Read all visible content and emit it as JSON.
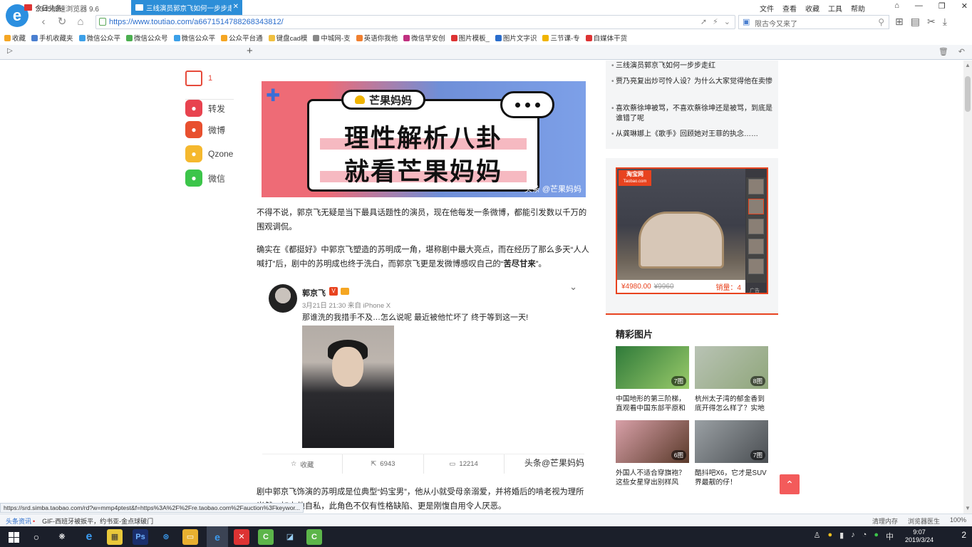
{
  "browser": {
    "title": "2345加速浏览器 9.6",
    "menu": [
      "文件",
      "查看",
      "收藏",
      "工具",
      "帮助"
    ],
    "url": "https://www.toutiao.com/a6671514788268343812/",
    "search_placeholder": "限古今又来了",
    "bookmarks": [
      {
        "label": "收藏",
        "color": "#f5a623"
      },
      {
        "label": "手机收藏夹",
        "color": "#4a7fd0"
      },
      {
        "label": "微信公众平",
        "color": "#3ca0e8"
      },
      {
        "label": "微信公众号",
        "color": "#4caf50"
      },
      {
        "label": "微信公众平",
        "color": "#3ca0e8"
      },
      {
        "label": "公众平台通",
        "color": "#f5a623"
      },
      {
        "label": "键盘cad模",
        "color": "#f0c040"
      },
      {
        "label": "中城网-支",
        "color": "#888888"
      },
      {
        "label": "英语你我他",
        "color": "#f08030"
      },
      {
        "label": "微信早安创",
        "color": "#c03080"
      },
      {
        "label": "图片模板_",
        "color": "#d33"
      },
      {
        "label": "图片文字识",
        "color": "#2a6dcc"
      },
      {
        "label": "三节课-专",
        "color": "#f0b400"
      },
      {
        "label": "自媒体干货",
        "color": "#d33"
      }
    ],
    "tabs": [
      {
        "label": "今日头条"
      },
      {
        "label": "三线演员郭京飞如何一步步走红"
      }
    ]
  },
  "share": {
    "comment_count": "1",
    "items": [
      {
        "label": "转发",
        "color": "#e8434f",
        "icon": "repost-icon"
      },
      {
        "label": "微博",
        "color": "#e8502f",
        "icon": "weibo-icon"
      },
      {
        "label": "Qzone",
        "color": "#f5b82e",
        "icon": "qzone-icon"
      },
      {
        "label": "微信",
        "color": "#3cc54a",
        "icon": "wechat-icon"
      }
    ]
  },
  "banner": {
    "brand": "芒果妈妈",
    "line1": "理性解析八卦",
    "line2": "就看芒果妈妈",
    "watermark": "头条 @芒果妈妈"
  },
  "article": {
    "p1": "不得不说，郭京飞无疑是当下最具话题性的演员，现在他每发一条微博，都能引发数以千万的围观调侃。",
    "p2_prefix": "确实在《都挺好》中郭京飞塑造的苏明成一角，堪称剧中最大亮点，而在经历了那么多天“人人喊打”后，剧中的苏明成也终于洗白，而郭京飞更是发微博感叹自己的“",
    "p2_bold": "苦尽甘来",
    "p2_suffix": "”。",
    "p3": "剧中郭京飞饰演的苏明成是位典型“妈宝男”，他从小就受母亲溺爱，并将婚后的啃老视为理所当然，加上他自私，此角色不仅有性格缺陷、更是刚愎自用令人厌恶。"
  },
  "weibo": {
    "name": "郭京飞",
    "time": "3月21日 21:30 来自 iPhone X",
    "text": "那谁洗的我措手不及…怎么说呢 最近被他忙坏了 终于等到这一天!",
    "actions": [
      {
        "label": "收藏",
        "icon": "star-icon"
      },
      {
        "label": "6943",
        "icon": "repost-icon"
      },
      {
        "label": "12214",
        "icon": "comment-icon"
      }
    ],
    "watermark": "头条@芒果妈妈"
  },
  "related": [
    "三线演员郭京飞如何一步步走红",
    "贾乃亮复出炒可怜人设？为什么大家觉得他在卖惨",
    "喜欢蔡徐坤被骂，不喜欢蔡徐坤还是被骂，到底是谁错了呢",
    "从龚琳娜上《歌手》回顾她对王菲的执念……"
  ],
  "ad": {
    "logo": "淘宝网",
    "logo_sub": "Taobao.com",
    "price": "¥4980.00",
    "old_price": "¥9960",
    "sales": "销量：4",
    "tag": "广告"
  },
  "pictures": {
    "title": "精彩图片",
    "items": [
      {
        "count": "7图",
        "caption": "中国地形的第三阶梯，直观看中国东部平原和",
        "colors": [
          "#2f7a3a",
          "#9acb6a"
        ]
      },
      {
        "count": "8图",
        "caption": "杭州太子湾的郁金香到底开得怎么样了？实地",
        "colors": [
          "#b9c3b5",
          "#8fa67a"
        ]
      },
      {
        "count": "6图",
        "caption": "外国人不适合穿旗袍？这些女星穿出别样风",
        "colors": [
          "#d8a0a8",
          "#5a3a2a"
        ]
      },
      {
        "count": "7图",
        "caption": "酷抖吧X6，它才是SUV界最靓的仔！",
        "colors": [
          "#9aa0a4",
          "#4a4e52"
        ]
      }
    ]
  },
  "link_preview": "https://srd.simba.taobao.com/rd?w=mmp4ptest&f=https%3A%2F%2Fre.taobao.com%2Fauction%3Fkeywor...",
  "statusbar": {
    "news": "头条资讯",
    "ticker": "GIF-西班牙被扳平，约书亚-金点球破门",
    "right": [
      "清理内存",
      "浏览器医生",
      "100%"
    ]
  },
  "taskbar": {
    "time": "9:07",
    "date": "2019/3/24",
    "notif": "2"
  }
}
